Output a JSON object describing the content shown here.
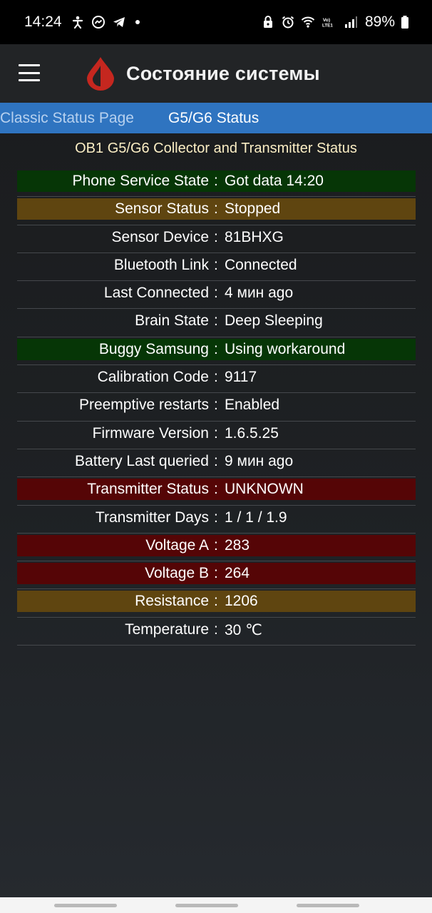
{
  "status_bar": {
    "time": "14:24",
    "battery": "89%",
    "left_icons": [
      "accessibility-icon",
      "messenger-icon",
      "telegram-icon",
      "notification-dot-icon"
    ],
    "right_icons": [
      "lock-icon",
      "alarm-icon",
      "wifi-icon",
      "volte-icon",
      "signal-icon",
      "battery-icon"
    ],
    "volte_label": "VoLTE1"
  },
  "toolbar": {
    "title": "Состояние системы",
    "logo_color": "#c5271f"
  },
  "tabs": [
    {
      "label": "Classic Status Page",
      "active": false
    },
    {
      "label": "G5/G6 Status",
      "active": true
    }
  ],
  "section_title": "OB1 G5/G6 Collector and Transmitter Status",
  "rows": [
    {
      "label": "Phone Service State",
      "value": "Got data 14:20",
      "highlight": "#063606"
    },
    {
      "label": "Sensor Status",
      "value": "Stopped",
      "highlight": "#5f4510"
    },
    {
      "label": "Sensor Device",
      "value": "81BHXG",
      "highlight": ""
    },
    {
      "label": "Bluetooth Link",
      "value": "Connected",
      "highlight": ""
    },
    {
      "label": "Last Connected",
      "value": "4 мин ago",
      "highlight": ""
    },
    {
      "label": "Brain State",
      "value": "Deep Sleeping",
      "highlight": ""
    },
    {
      "label": "Buggy Samsung",
      "value": "Using workaround",
      "highlight": "#063606"
    },
    {
      "label": "Calibration Code",
      "value": "9117",
      "highlight": ""
    },
    {
      "label": "Preemptive restarts",
      "value": "Enabled",
      "highlight": ""
    },
    {
      "label": "Firmware Version",
      "value": "1.6.5.25",
      "highlight": ""
    },
    {
      "label": "Battery Last queried",
      "value": "9 мин ago",
      "highlight": ""
    },
    {
      "label": "Transmitter Status",
      "value": "UNKNOWN",
      "highlight": "#550506"
    },
    {
      "label": "Transmitter Days",
      "value": "1 / 1 / 1.9",
      "highlight": ""
    },
    {
      "label": "Voltage A",
      "value": "283",
      "highlight": "#550506"
    },
    {
      "label": "Voltage B",
      "value": "264",
      "highlight": "#550506"
    },
    {
      "label": "Resistance",
      "value": "1206",
      "highlight": "#5f4510"
    },
    {
      "label": "Temperature",
      "value": "30 ℃",
      "highlight": ""
    }
  ],
  "separator": ":"
}
